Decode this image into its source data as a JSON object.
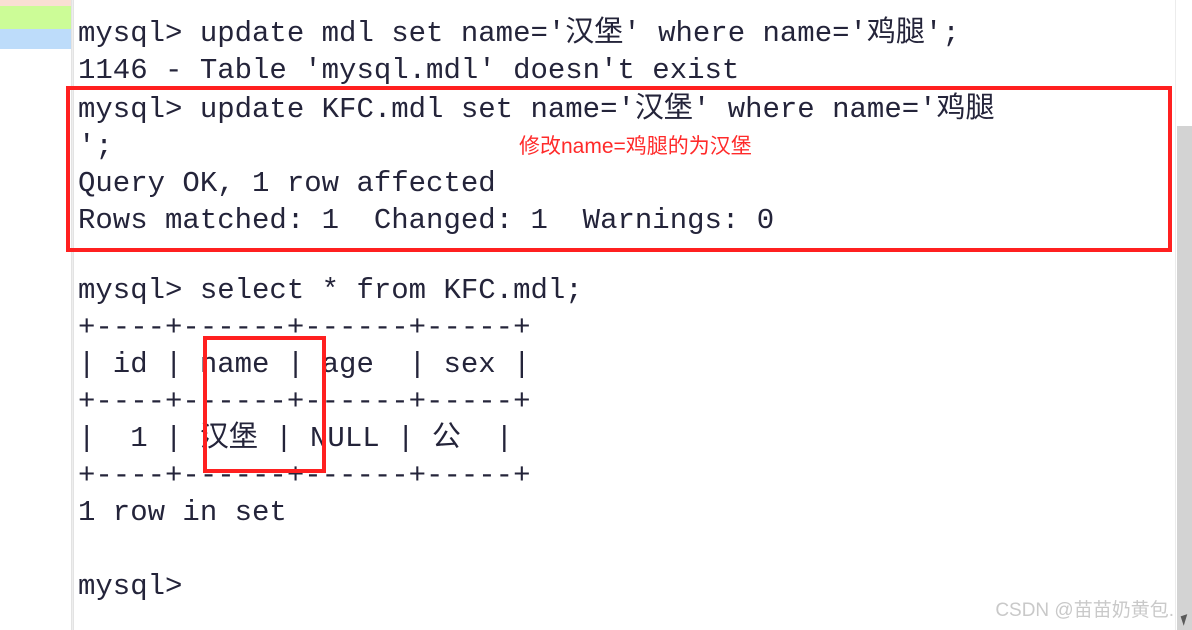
{
  "markers": {
    "pink_color": "#f9dfd4",
    "green_color": "#ccfc97",
    "blue_color": "#bddcfa"
  },
  "terminal": {
    "lines": [
      "mysql> update mdl set name='汉堡' where name='鸡腿';",
      "1146 - Table 'mysql.mdl' doesn't exist",
      "mysql> update KFC.mdl set name='汉堡' where name='鸡腿",
      "';",
      "Query OK, 1 row affected",
      "Rows matched: 1  Changed: 1  Warnings: 0",
      "",
      "mysql> select * from KFC.mdl;",
      "+----+------+------+-----+",
      "| id | name | age  | sex |",
      "+----+------+------+-----+",
      "|  1 | 汉堡 | NULL | 公  |",
      "+----+------+------+-----+",
      "1 row in set",
      "",
      "mysql>"
    ]
  },
  "table_result": {
    "columns": [
      "id",
      "name",
      "age",
      "sex"
    ],
    "rows": [
      [
        "1",
        "汉堡",
        "NULL",
        "公"
      ]
    ],
    "row_count_text": "1 row in set"
  },
  "annotations": {
    "note_text": "修改name=鸡腿的为汉堡",
    "note_color": "#ff2a2a",
    "box_color": "#ff2020"
  },
  "watermark": {
    "text": "CSDN @苗苗奶黄包."
  }
}
